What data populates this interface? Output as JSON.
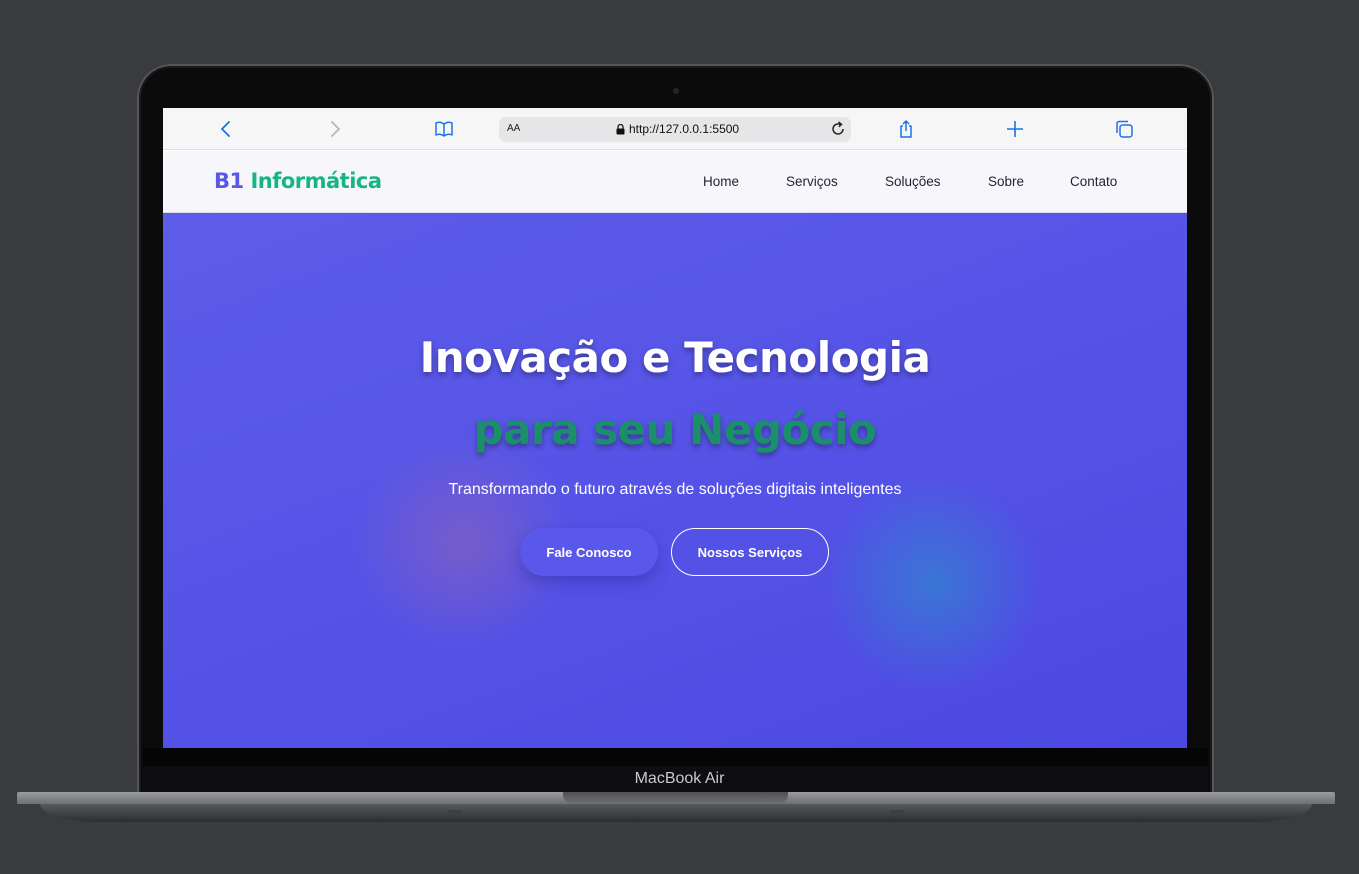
{
  "device": {
    "model_label": "MacBook Air"
  },
  "browser": {
    "aa_label": "AA",
    "url": "http://127.0.0.1:5500",
    "icons": [
      "back-icon",
      "forward-icon",
      "bookmarks-icon",
      "lock-icon",
      "reload-icon",
      "share-icon",
      "new-tab-icon",
      "tabs-icon"
    ]
  },
  "site": {
    "logo": {
      "part1": "B1",
      "part2": "Informática"
    },
    "nav": [
      {
        "label": "Home"
      },
      {
        "label": "Serviços"
      },
      {
        "label": "Soluções"
      },
      {
        "label": "Sobre"
      },
      {
        "label": "Contato"
      }
    ],
    "hero": {
      "title_line1": "Inovação e Tecnologia",
      "title_line2": "para seu Negócio",
      "subtitle": "Transformando o futuro através de soluções digitais inteligentes",
      "primary_button": "Fale Conosco",
      "secondary_button": "Nossos Serviços"
    }
  },
  "colors": {
    "hero_bg": "#5452e6",
    "accent_green": "#17b582",
    "logo_blue": "#5b57e6",
    "ios_blue": "#1a73e8"
  }
}
